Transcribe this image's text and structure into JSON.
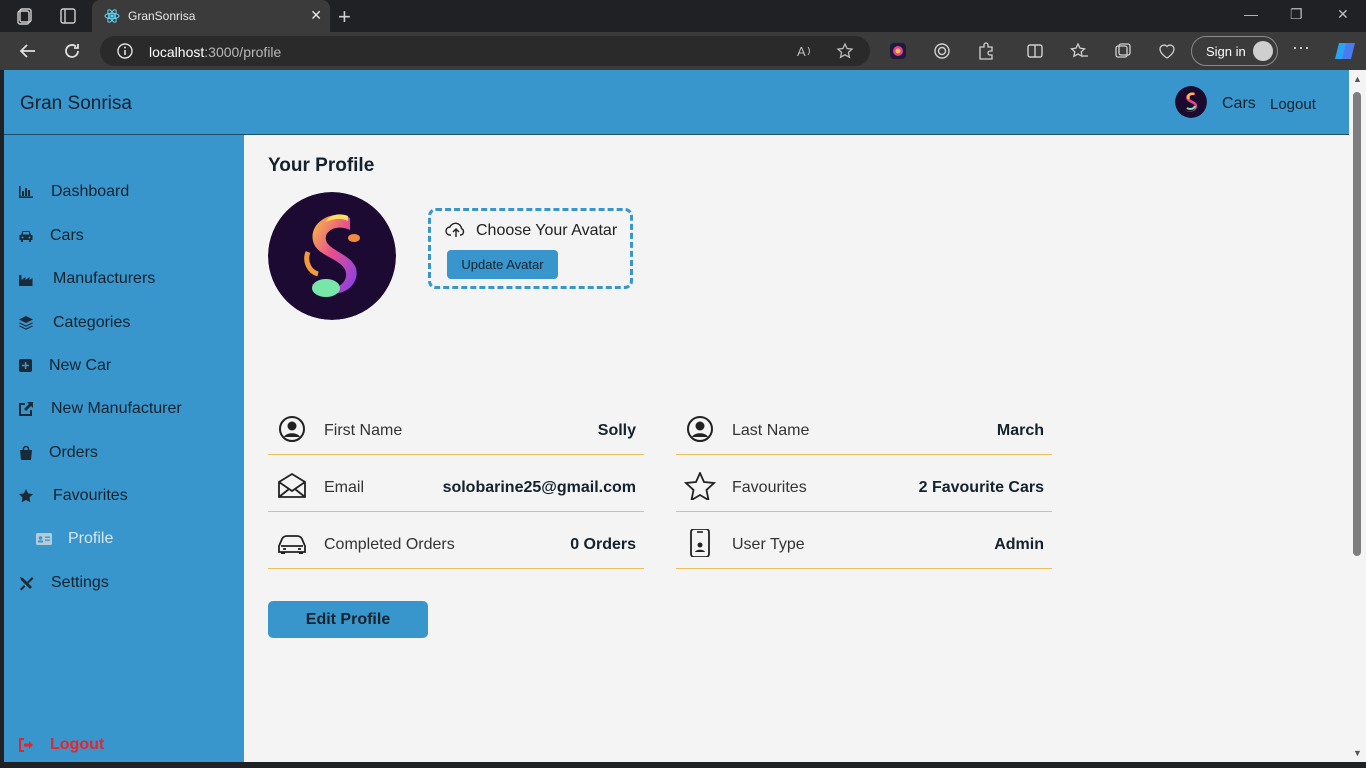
{
  "browser": {
    "tab_title": "GranSonrisa",
    "url_host": "localhost",
    "url_path": ":3000/profile",
    "signin_label": "Sign in"
  },
  "nav": {
    "brand": "Gran Sonrisa",
    "cars": "Cars",
    "logout": "Logout"
  },
  "sidebar": {
    "items": [
      {
        "label": "Dashboard",
        "icon": "chart-icon"
      },
      {
        "label": "Cars",
        "icon": "car-icon"
      },
      {
        "label": "Manufacturers",
        "icon": "factory-icon"
      },
      {
        "label": "Categories",
        "icon": "layers-icon"
      },
      {
        "label": "New Car",
        "icon": "plus-square-icon"
      },
      {
        "label": "New Manufacturer",
        "icon": "external-link-icon"
      },
      {
        "label": "Orders",
        "icon": "bag-icon"
      },
      {
        "label": "Favourites",
        "icon": "star-icon"
      },
      {
        "label": "Profile",
        "icon": "id-card-icon"
      },
      {
        "label": "Settings",
        "icon": "tools-icon"
      }
    ],
    "logout": "Logout"
  },
  "profile": {
    "title": "Your Profile",
    "choose_avatar": "Choose Your Avatar",
    "update_avatar": "Update Avatar",
    "fields": [
      {
        "label": "First Name",
        "value": "Solly",
        "icon": "user-circle-icon"
      },
      {
        "label": "Last Name",
        "value": "March",
        "icon": "user-circle-icon"
      },
      {
        "label": "Email",
        "value": "solobarine25@gmail.com",
        "icon": "envelope-icon"
      },
      {
        "label": "Favourites",
        "value": "2 Favourite Cars",
        "icon": "star-outline-icon"
      },
      {
        "label": "Completed Orders",
        "value": "0 Orders",
        "icon": "car-outline-icon"
      },
      {
        "label": "User Type",
        "value": "Admin",
        "icon": "phone-badge-icon"
      }
    ],
    "edit_button": "Edit Profile"
  },
  "colors": {
    "primary": "#3996cd",
    "background": "#f4f4f4",
    "divider": "#e8c15a",
    "danger": "#e8242a"
  }
}
